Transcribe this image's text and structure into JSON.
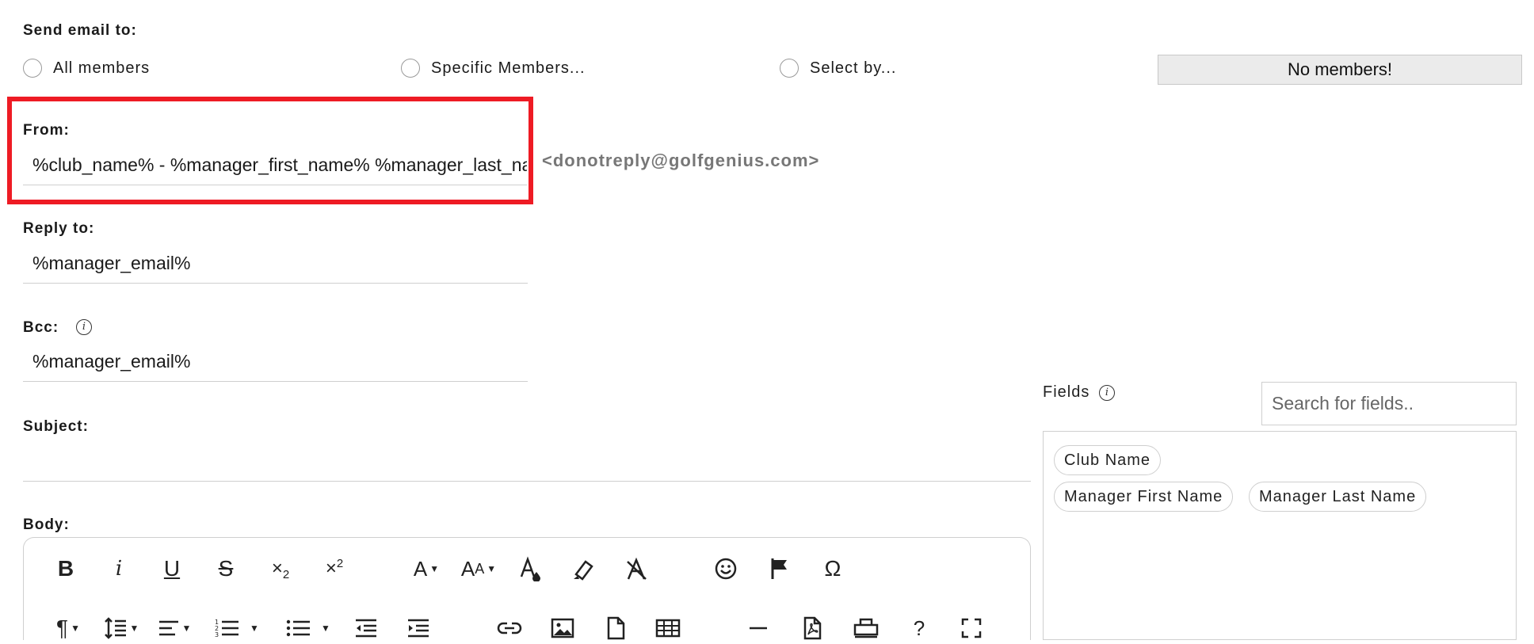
{
  "send_to": {
    "label": "Send email to:",
    "options": [
      "All members",
      "Specific Members...",
      "Select by..."
    ],
    "status_button": "No members!"
  },
  "from": {
    "label": "From:",
    "value": "%club_name% - %manager_first_name%  %manager_last_name%",
    "suffix": "<donotreply@golfgenius.com>"
  },
  "reply_to": {
    "label": "Reply to:",
    "value": "%manager_email%"
  },
  "bcc": {
    "label": "Bcc:",
    "value": "%manager_email%",
    "info_icon": "i"
  },
  "subject": {
    "label": "Subject:",
    "value": ""
  },
  "body": {
    "label": "Body:"
  },
  "fields": {
    "label": "Fields",
    "info_icon": "i",
    "search_placeholder": "Search for fields..",
    "chips": [
      "Club Name",
      "Manager First Name",
      "Manager Last Name"
    ]
  },
  "toolbar": {
    "row1": [
      "bold-icon",
      "italic-icon",
      "underline-icon",
      "strikethrough-icon",
      "subscript-icon",
      "superscript-icon",
      "font-family-icon",
      "font-size-icon",
      "text-color-icon",
      "background-color-icon",
      "clear-formatting-icon",
      "emoticons-icon",
      "flag-icon",
      "special-characters-icon"
    ],
    "row2": [
      "paragraph-format-icon",
      "line-height-icon",
      "align-icon",
      "ordered-list-icon",
      "unordered-list-icon",
      "outdent-icon",
      "indent-icon",
      "insert-link-icon",
      "insert-image-icon",
      "insert-file-icon",
      "insert-table-icon",
      "horizontal-line-icon",
      "pdf-icon",
      "print-icon",
      "help-icon",
      "fullscreen-icon"
    ]
  }
}
